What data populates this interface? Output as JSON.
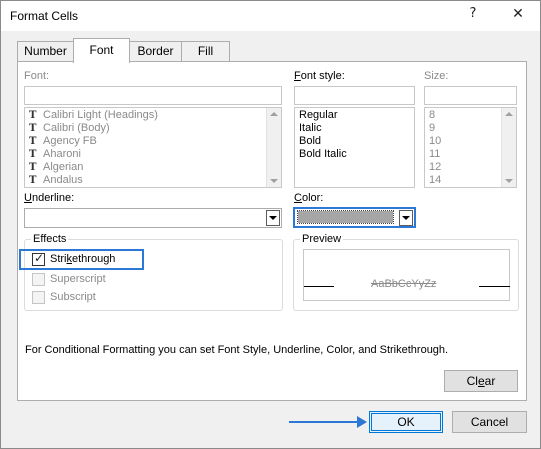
{
  "window": {
    "title": "Format Cells",
    "help_glyph": "?",
    "close_glyph": "✕"
  },
  "tabs": [
    {
      "label": "Number",
      "active": false
    },
    {
      "label": "Font",
      "active": true
    },
    {
      "label": "Border",
      "active": false
    },
    {
      "label": "Fill",
      "active": false
    }
  ],
  "font": {
    "label": "Font:",
    "value": "",
    "items": [
      {
        "name": "Calibri Light (Headings)",
        "icon": "truetype-icon"
      },
      {
        "name": "Calibri (Body)",
        "icon": "truetype-icon"
      },
      {
        "name": "Agency FB",
        "icon": "truetype-icon"
      },
      {
        "name": "Aharoni",
        "icon": "truetype-icon"
      },
      {
        "name": "Algerian",
        "icon": "truetype-icon"
      },
      {
        "name": "Andalus",
        "icon": "truetype-icon"
      }
    ]
  },
  "font_style": {
    "label_prefix": "F",
    "label_rest": "ont style:",
    "value": "",
    "items": [
      "Regular",
      "Italic",
      "Bold",
      "Bold Italic"
    ]
  },
  "size": {
    "label": "Size:",
    "value": "",
    "items": [
      "8",
      "9",
      "10",
      "11",
      "12",
      "14"
    ]
  },
  "underline": {
    "label_prefix": "U",
    "label_rest": "nderline:",
    "value": ""
  },
  "color": {
    "label_prefix": "C",
    "label_rest": "olor:",
    "swatch_color": "#a6a6a6"
  },
  "effects": {
    "title": "Effects",
    "strikethrough": {
      "label_pre": "Stri",
      "label_u": "k",
      "label_post": "ethrough",
      "checked": true
    },
    "superscript": {
      "label": "Superscript",
      "checked": false
    },
    "subscript": {
      "label": "Subscript",
      "checked": false
    }
  },
  "preview": {
    "title": "Preview",
    "sample": "AaBbCcYyZz"
  },
  "info_text": "For Conditional Formatting you can set Font Style, Underline, Color, and Strikethrough.",
  "buttons": {
    "clear_pre": "Cl",
    "clear_u": "e",
    "clear_post": "ar",
    "ok": "OK",
    "cancel": "Cancel"
  },
  "colors": {
    "accent": "#2b78d6",
    "disabled_text": "#8a8a8a"
  }
}
